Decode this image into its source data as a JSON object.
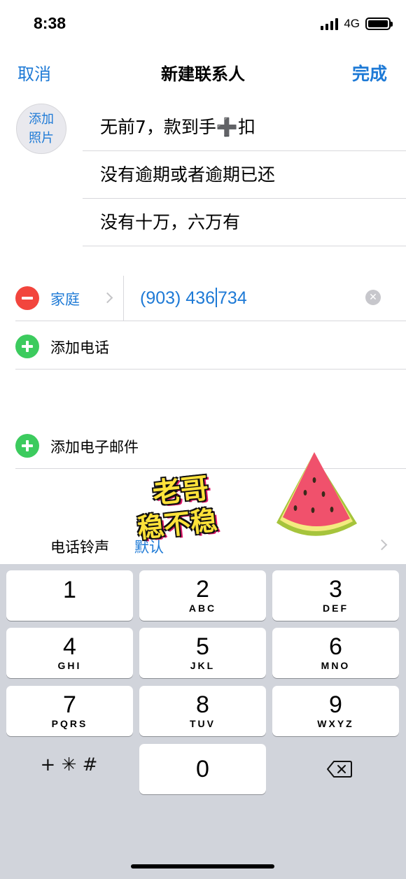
{
  "status_bar": {
    "time": "8:38",
    "network": "4G"
  },
  "nav": {
    "cancel": "取消",
    "title": "新建联系人",
    "done": "完成"
  },
  "photo": {
    "line1": "添加",
    "line2": "照片"
  },
  "name_fields": [
    {
      "value": "无前7，款到手➕扣"
    },
    {
      "value": "没有逾期或者逾期已还"
    },
    {
      "value": "没有十万，六万有"
    }
  ],
  "phone": {
    "label": "家庭",
    "value_before_caret": "(903) 436",
    "value_after_caret": "734"
  },
  "add_phone": "添加电话",
  "add_email": "添加电子邮件",
  "ringtone": {
    "label": "电话铃声",
    "value": "默认"
  },
  "sticker": {
    "line1": "老哥",
    "line2": "稳不稳"
  },
  "keypad": {
    "keys": [
      {
        "num": "1",
        "letters": ""
      },
      {
        "num": "2",
        "letters": "ABC"
      },
      {
        "num": "3",
        "letters": "DEF"
      },
      {
        "num": "4",
        "letters": "GHI"
      },
      {
        "num": "5",
        "letters": "JKL"
      },
      {
        "num": "6",
        "letters": "MNO"
      },
      {
        "num": "7",
        "letters": "PQRS"
      },
      {
        "num": "8",
        "letters": "TUV"
      },
      {
        "num": "9",
        "letters": "WXYZ"
      },
      {
        "num": "0",
        "letters": ""
      }
    ],
    "symbols": "+ ✳ #"
  },
  "colors": {
    "accent": "#1e7ad6",
    "delete": "#f2453d",
    "add": "#3ccb5e",
    "keypad_bg": "#d1d4db"
  },
  "icons": [
    "signal-bars-icon",
    "battery-icon",
    "minus-circle-icon",
    "plus-circle-icon",
    "chevron-right-icon",
    "clear-icon",
    "backspace-icon",
    "watermelon-sticker"
  ]
}
